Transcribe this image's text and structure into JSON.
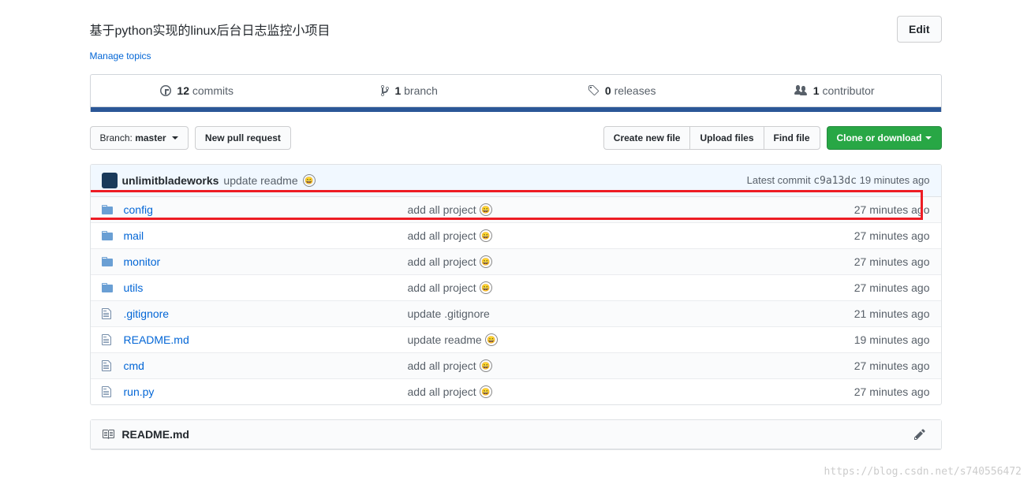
{
  "description": "基于python实现的linux后台日志监控小项目",
  "edit_label": "Edit",
  "manage_topics": "Manage topics",
  "stats": {
    "commits_n": "12",
    "commits_label": " commits",
    "branch_n": "1",
    "branch_label": " branch",
    "releases_n": "0",
    "releases_label": " releases",
    "contrib_n": "1",
    "contrib_label": " contributor"
  },
  "nav": {
    "branch_prefix": "Branch: ",
    "branch_name": "master",
    "new_pr": "New pull request",
    "create_file": "Create new file",
    "upload_files": "Upload files",
    "find_file": "Find file",
    "clone": "Clone or download"
  },
  "commit": {
    "author": "unlimitbladeworks",
    "message": "update readme",
    "right_prefix": "Latest commit ",
    "sha": "c9a13dc",
    "time": " 19 minutes ago"
  },
  "files": [
    {
      "type": "dir",
      "name": "config",
      "msg": "add all project",
      "emoji": true,
      "time": "27 minutes ago"
    },
    {
      "type": "dir",
      "name": "mail",
      "msg": "add all project",
      "emoji": true,
      "time": "27 minutes ago"
    },
    {
      "type": "dir",
      "name": "monitor",
      "msg": "add all project",
      "emoji": true,
      "time": "27 minutes ago"
    },
    {
      "type": "dir",
      "name": "utils",
      "msg": "add all project",
      "emoji": true,
      "time": "27 minutes ago"
    },
    {
      "type": "file",
      "name": ".gitignore",
      "msg": "update .gitignore",
      "emoji": false,
      "time": "21 minutes ago"
    },
    {
      "type": "file",
      "name": "README.md",
      "msg": "update readme",
      "emoji": true,
      "time": "19 minutes ago"
    },
    {
      "type": "file",
      "name": "cmd",
      "msg": "add all project",
      "emoji": true,
      "time": "27 minutes ago"
    },
    {
      "type": "file",
      "name": "run.py",
      "msg": "add all project",
      "emoji": true,
      "time": "27 minutes ago"
    }
  ],
  "readme_title": "README.md",
  "watermark": "https://blog.csdn.net/s740556472",
  "emoji_glyph": "😄"
}
